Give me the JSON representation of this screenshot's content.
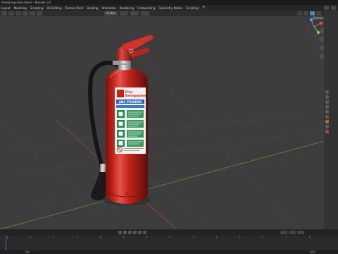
{
  "window": {
    "title": "fireextinguisher.blend - Blender 3.6"
  },
  "menu": {
    "items": [
      "Layout",
      "Modeling",
      "Sculpting",
      "UV Editing",
      "Texture Paint",
      "Shading",
      "Animation",
      "Rendering",
      "Compositing",
      "Geometry Nodes",
      "Scripting"
    ]
  },
  "viewport": {
    "header": {
      "orientation_value": "Global",
      "options_label": "Options"
    }
  },
  "label": {
    "brand_line1": "Fire",
    "brand_line2": "Extinguisher",
    "agent": "ABC POWDER"
  },
  "colors": {
    "background": "#3d3d3d",
    "extinguisher_red": "#c4231a",
    "label_white": "#f1f1ef",
    "label_blue": "#2c63b5",
    "label_green": "#1d8a4a",
    "axis_x": "#a0454b",
    "axis_y": "#6c8a3c",
    "active_tab": "#5b7fb3"
  }
}
